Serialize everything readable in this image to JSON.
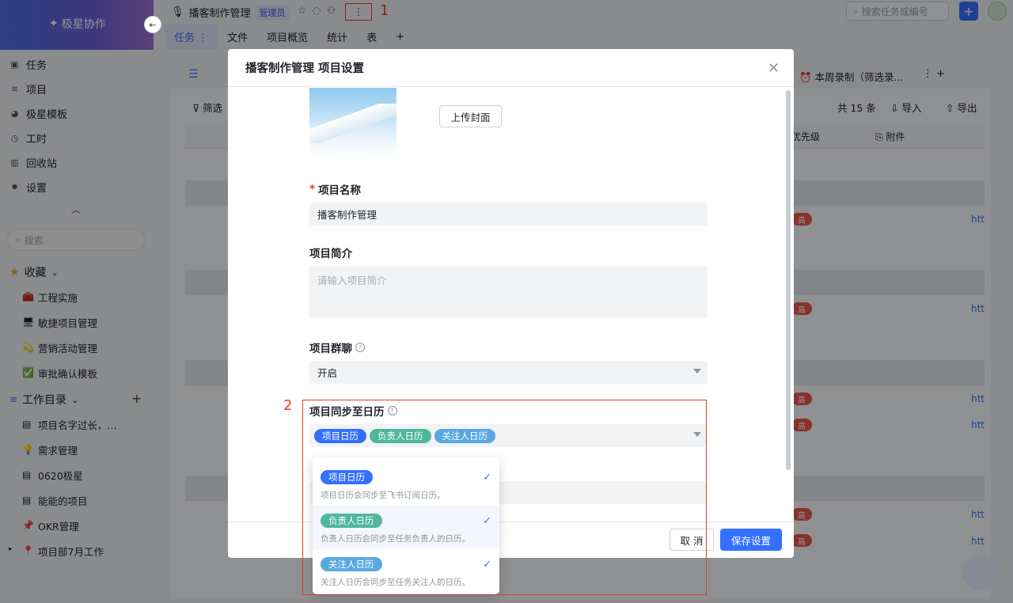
{
  "sidebar": {
    "brand": "极星协作",
    "nav": [
      {
        "label": "任务",
        "icon": "task-icon"
      },
      {
        "label": "项目",
        "icon": "layers-icon"
      },
      {
        "label": "极星模板",
        "icon": "template-icon"
      },
      {
        "label": "工时",
        "icon": "clock-icon"
      },
      {
        "label": "回收站",
        "icon": "trash-icon"
      },
      {
        "label": "设置",
        "icon": "gear-icon"
      }
    ],
    "search_placeholder": "搜索",
    "favorites": {
      "title": "收藏",
      "items": [
        {
          "emoji": "🧰",
          "label": "工程实施"
        },
        {
          "emoji": "🖥",
          "label": "敏捷项目管理"
        },
        {
          "emoji": "💫",
          "label": "营销活动管理"
        },
        {
          "emoji": "✅",
          "label": "审批确认模板"
        }
      ]
    },
    "workspace": {
      "title": "工作目录",
      "items": [
        {
          "emoji": "▤",
          "label": "项目名字过长，..."
        },
        {
          "emoji": "💡",
          "label": "需求管理"
        },
        {
          "emoji": "▤",
          "label": "0620极星"
        },
        {
          "emoji": "▤",
          "label": "能能的项目"
        },
        {
          "emoji": "📌",
          "label": "OKR管理"
        },
        {
          "emoji": "📍",
          "label": "项目部7月工作"
        }
      ]
    }
  },
  "topbar": {
    "project_title": "播客制作管理",
    "role_badge": "管理员",
    "more_label": "⋮",
    "annotation_1": "1",
    "search_placeholder": "搜索任务或编号"
  },
  "tabs": [
    {
      "label": "任务 ⋮",
      "active": true
    },
    {
      "label": "文件"
    },
    {
      "label": "项目概览"
    },
    {
      "label": "统计"
    },
    {
      "label": "表"
    },
    {
      "label": "+"
    }
  ],
  "background": {
    "view_tab": "⏰ 本周录制（筛选录...",
    "filter_label": "筛选",
    "count_label": "共 15 条",
    "import_label": "导入",
    "export_label": "导出",
    "col_priority": "优先级",
    "col_attachment": "附件",
    "priority_tag": "高",
    "link_text": "htt"
  },
  "modal": {
    "title": "播客制作管理 项目设置",
    "upload_cover": "上传封面",
    "name_label": "项目名称",
    "name_value": "播客制作管理",
    "intro_label": "项目简介",
    "intro_placeholder": "请输入项目简介",
    "chat_label": "项目群聊",
    "chat_value": "开启",
    "sync_label": "项目同步至日历",
    "sync_chips": [
      "项目日历",
      "负责人日历",
      "关注人日历"
    ],
    "cancel": "取 消",
    "save": "保存设置",
    "annotation_2": "2"
  },
  "dropdown": [
    {
      "chip": "项目日历",
      "desc": "项目日历会同步至飞书订阅日历。",
      "checked": true
    },
    {
      "chip": "负责人日历",
      "desc": "负责人日历会同步至任务负责人的日历。",
      "checked": true
    },
    {
      "chip": "关注人日历",
      "desc": "关注人日历会同步至任务关注人的日历。",
      "checked": true
    }
  ]
}
